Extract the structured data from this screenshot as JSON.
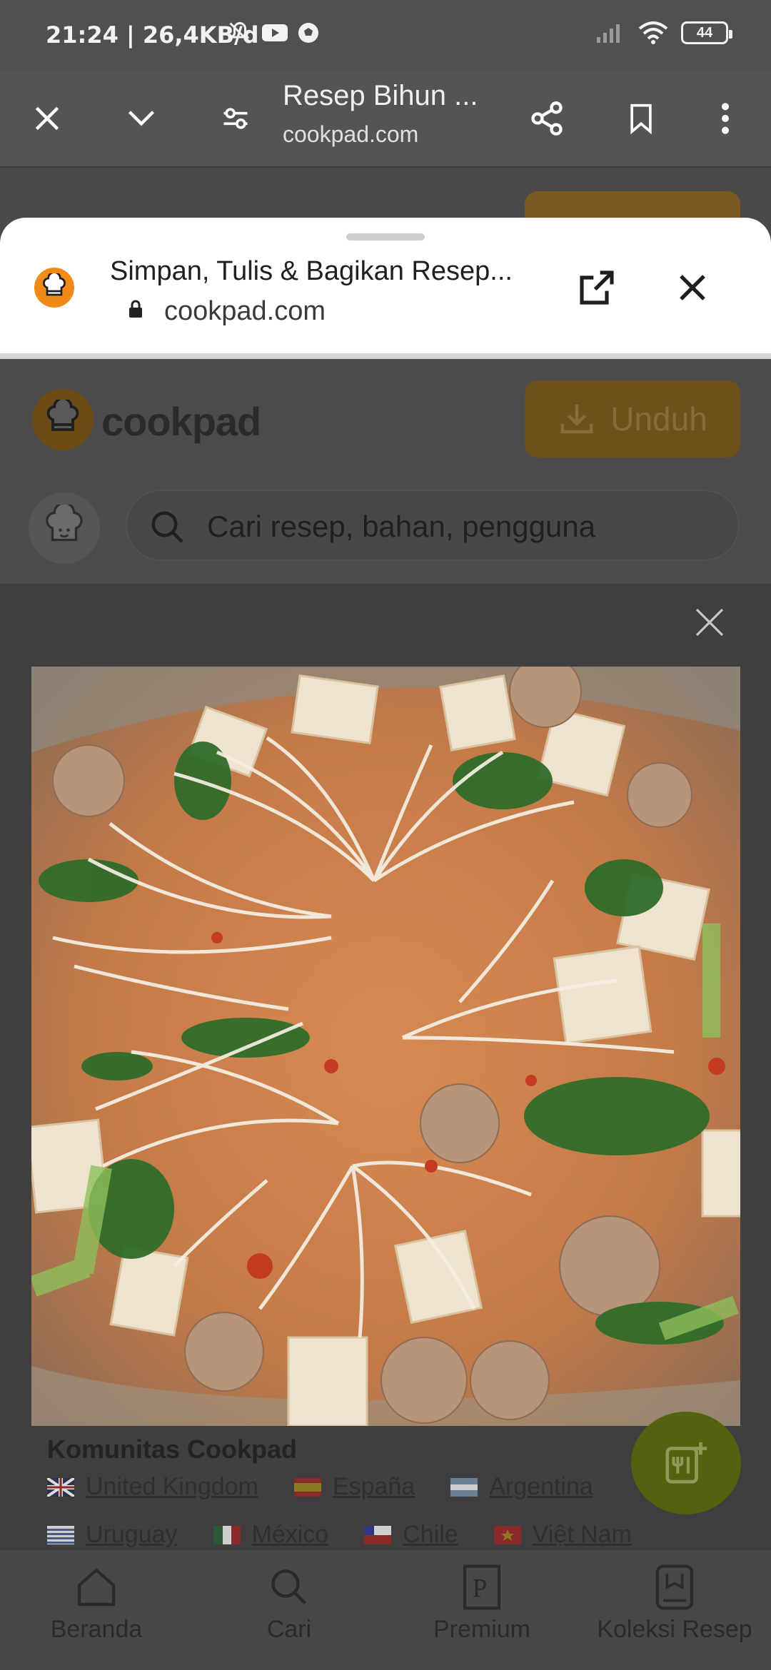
{
  "status_bar": {
    "time": "21:24 | 26,4KB/d",
    "battery": "44"
  },
  "toolbar": {
    "title": "Resep Bihun ...",
    "url": "cookpad.com",
    "icons": [
      "close-icon",
      "chevron-down-icon",
      "tune-icon",
      "share-icon",
      "bookmark-icon",
      "more-vert-icon"
    ]
  },
  "sheet": {
    "title": "Simpan, Tulis & Bagikan Resep...",
    "url": "cookpad.com"
  },
  "cookpad": {
    "brand": "cookpad",
    "download_label": "Unduh",
    "search_placeholder": "Cari resep, bahan, pengguna"
  },
  "community": {
    "title": "Komunitas Cookpad",
    "countries_row1": [
      "United Kingdom",
      "España",
      "Argentina"
    ],
    "countries_row2": [
      "Uruguay",
      "México",
      "Chile",
      "Việt Nam"
    ]
  },
  "bottom_nav": {
    "items": [
      "Beranda",
      "Cari",
      "Premium",
      "Koleksi Resep"
    ]
  },
  "colors": {
    "brand_orange": "#f08a18",
    "sheet_bg": "#ffffff",
    "overlay": "#3f3f3f"
  }
}
